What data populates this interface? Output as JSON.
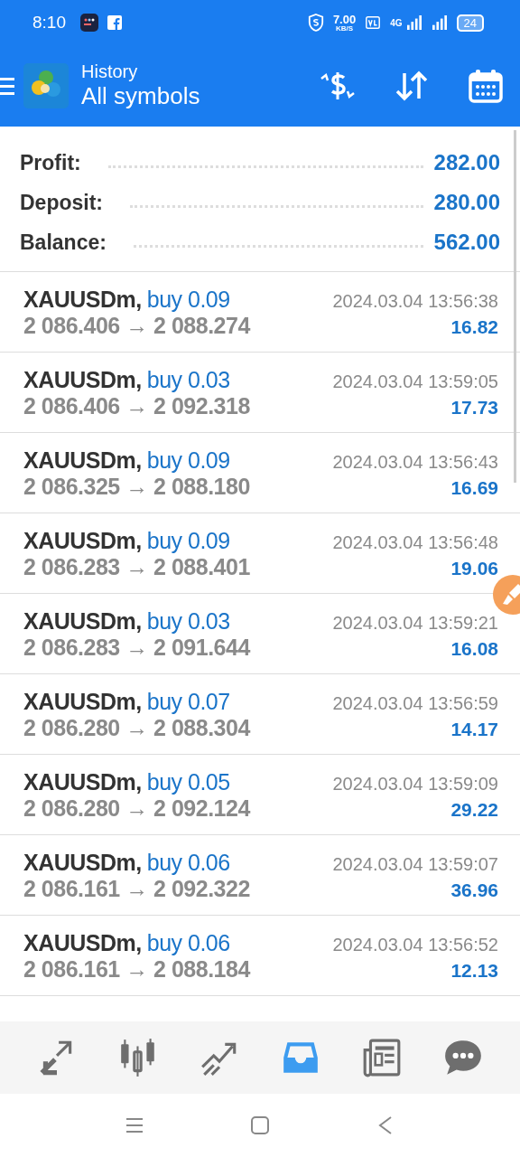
{
  "status_bar": {
    "time": "8:10",
    "speed": "7.00",
    "speed_unit": "KB/S",
    "network": "4G",
    "battery": "24"
  },
  "header": {
    "title": "History",
    "subtitle": "All symbols"
  },
  "summary": [
    {
      "label": "Profit:",
      "value": "282.00"
    },
    {
      "label": "Deposit:",
      "value": "280.00"
    },
    {
      "label": "Balance:",
      "value": "562.00"
    }
  ],
  "deals": [
    {
      "symbol": "XAUUSDm,",
      "side": "buy",
      "volume": "0.09",
      "prices": "2 086.406 → 2 088.274",
      "time": "2024.03.04 13:56:38",
      "profit": "16.82"
    },
    {
      "symbol": "XAUUSDm,",
      "side": "buy",
      "volume": "0.03",
      "prices": "2 086.406 → 2 092.318",
      "time": "2024.03.04 13:59:05",
      "profit": "17.73"
    },
    {
      "symbol": "XAUUSDm,",
      "side": "buy",
      "volume": "0.09",
      "prices": "2 086.325 → 2 088.180",
      "time": "2024.03.04 13:56:43",
      "profit": "16.69"
    },
    {
      "symbol": "XAUUSDm,",
      "side": "buy",
      "volume": "0.09",
      "prices": "2 086.283 → 2 088.401",
      "time": "2024.03.04 13:56:48",
      "profit": "19.06"
    },
    {
      "symbol": "XAUUSDm,",
      "side": "buy",
      "volume": "0.03",
      "prices": "2 086.283 → 2 091.644",
      "time": "2024.03.04 13:59:21",
      "profit": "16.08"
    },
    {
      "symbol": "XAUUSDm,",
      "side": "buy",
      "volume": "0.07",
      "prices": "2 086.280 → 2 088.304",
      "time": "2024.03.04 13:56:59",
      "profit": "14.17"
    },
    {
      "symbol": "XAUUSDm,",
      "side": "buy",
      "volume": "0.05",
      "prices": "2 086.280 → 2 092.124",
      "time": "2024.03.04 13:59:09",
      "profit": "29.22"
    },
    {
      "symbol": "XAUUSDm,",
      "side": "buy",
      "volume": "0.06",
      "prices": "2 086.161 → 2 092.322",
      "time": "2024.03.04 13:59:07",
      "profit": "36.96"
    },
    {
      "symbol": "XAUUSDm,",
      "side": "buy",
      "volume": "0.06",
      "prices": "2 086.161 → 2 088.184",
      "time": "2024.03.04 13:56:52",
      "profit": "12.13"
    }
  ],
  "bottom_nav": [
    {
      "kind": "quotes",
      "selected": false
    },
    {
      "kind": "chart",
      "selected": false
    },
    {
      "kind": "trade",
      "selected": false
    },
    {
      "kind": "history",
      "selected": true
    },
    {
      "kind": "news",
      "selected": false
    },
    {
      "kind": "chat",
      "selected": false
    }
  ]
}
